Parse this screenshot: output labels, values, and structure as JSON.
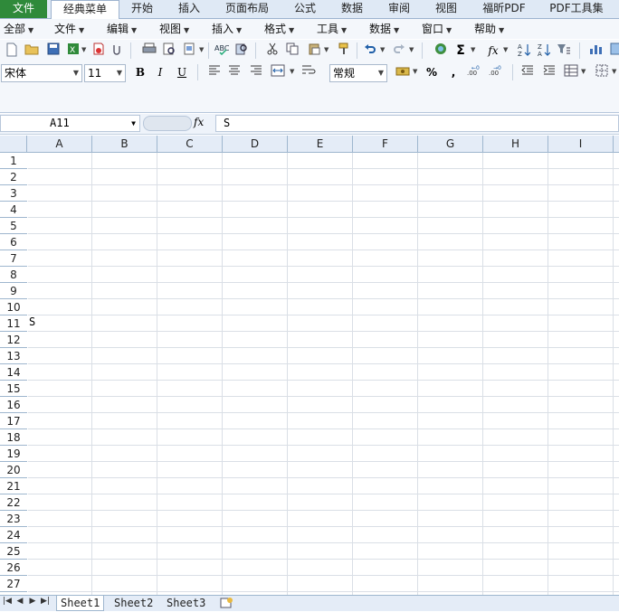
{
  "ribbon_tabs": [
    "文件",
    "经典菜单",
    "开始",
    "插入",
    "页面布局",
    "公式",
    "数据",
    "审阅",
    "视图",
    "福昕PDF",
    "PDF工具集"
  ],
  "menu_items": [
    "全部",
    "文件",
    "编辑",
    "视图",
    "插入",
    "格式",
    "工具",
    "数据",
    "窗口",
    "帮助"
  ],
  "font_name": "宋体",
  "font_size": "11",
  "number_format": "常规",
  "format_buttons": {
    "bold": "B",
    "italic": "I",
    "underline": "U"
  },
  "symbols": {
    "sum": "Σ",
    "fx": "fx",
    "percent": "%",
    "comma": ","
  },
  "name_box": "A11",
  "formula_value": "S",
  "columns": [
    "A",
    "B",
    "C",
    "D",
    "E",
    "F",
    "G",
    "H",
    "I"
  ],
  "rows": [
    "1",
    "2",
    "3",
    "4",
    "5",
    "6",
    "7",
    "8",
    "9",
    "10",
    "11",
    "12",
    "13",
    "14",
    "15",
    "16",
    "17",
    "18",
    "19",
    "20",
    "21",
    "22",
    "23",
    "24",
    "25",
    "26",
    "27"
  ],
  "cell_A11": "S",
  "sheets": [
    "Sheet1",
    "Sheet2",
    "Sheet3"
  ],
  "active_sheet": "Sheet1"
}
